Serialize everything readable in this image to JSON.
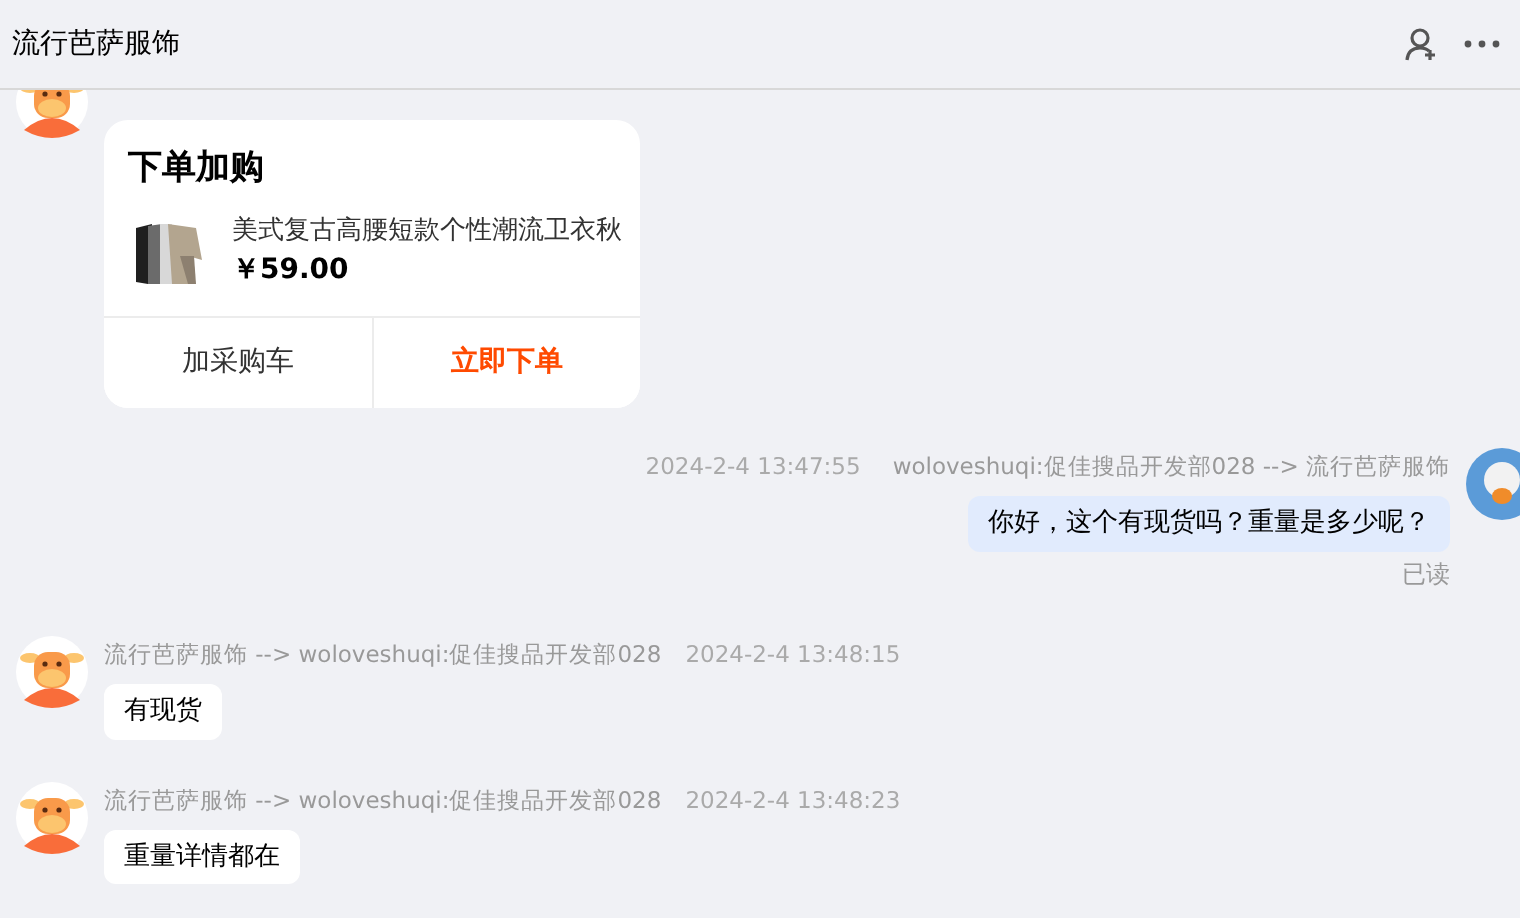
{
  "header": {
    "title": "流行芭萨服饰"
  },
  "messages": [
    {
      "kind": "card",
      "outgoing": false,
      "card": {
        "title": "下单加购",
        "product": {
          "name": "美式复古高腰短款个性潮流卫衣秋",
          "price": "￥59.00"
        },
        "actions": [
          {
            "label": "加采购车",
            "primary": false
          },
          {
            "label": "立即下单",
            "primary": true
          }
        ]
      }
    },
    {
      "kind": "text",
      "outgoing": true,
      "time": "2024-2-4 13:47:55",
      "route": "woloveshuqi:促佳搜品开发部028 --> 流行芭萨服饰",
      "text": "你好，这个有现货吗？重量是多少呢？",
      "status": "已读"
    },
    {
      "kind": "text",
      "outgoing": false,
      "route": "流行芭萨服饰 --> woloveshuqi:促佳搜品开发部028",
      "time": "2024-2-4 13:48:15",
      "text": "有现货"
    },
    {
      "kind": "text",
      "outgoing": false,
      "route": "流行芭萨服饰 --> woloveshuqi:促佳搜品开发部028",
      "time": "2024-2-4 13:48:23",
      "text": "重量详情都在"
    }
  ]
}
